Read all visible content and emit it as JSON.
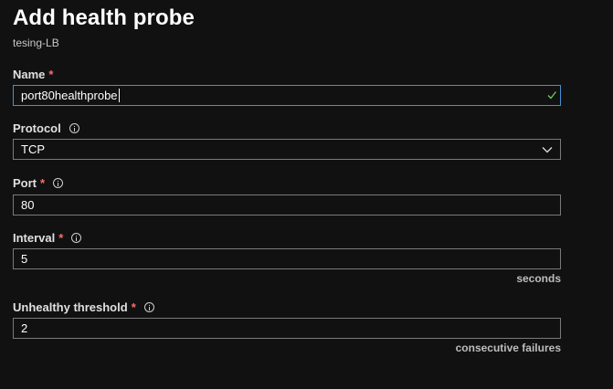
{
  "header": {
    "title": "Add health probe",
    "subtitle": "tesing-LB"
  },
  "form": {
    "name": {
      "label": "Name",
      "required_mark": "*",
      "value": "port80healthprobe",
      "status_icon": "check-icon"
    },
    "protocol": {
      "label": "Protocol",
      "info_icon": "info-icon",
      "selected": "TCP",
      "dropdown_icon": "chevron-down-icon"
    },
    "port": {
      "label": "Port",
      "required_mark": "*",
      "info_icon": "info-icon",
      "value": "80"
    },
    "interval": {
      "label": "Interval",
      "required_mark": "*",
      "info_icon": "info-icon",
      "value": "5",
      "unit": "seconds"
    },
    "unhealthy_threshold": {
      "label": "Unhealthy threshold",
      "required_mark": "*",
      "info_icon": "info-icon",
      "value": "2",
      "unit": "consecutive failures"
    }
  },
  "colors": {
    "background": "#111111",
    "required": "#ff6b6b",
    "focus_border": "#4a8fd4",
    "valid_check": "#6ccb5f",
    "field_border": "#7a7a7a"
  }
}
